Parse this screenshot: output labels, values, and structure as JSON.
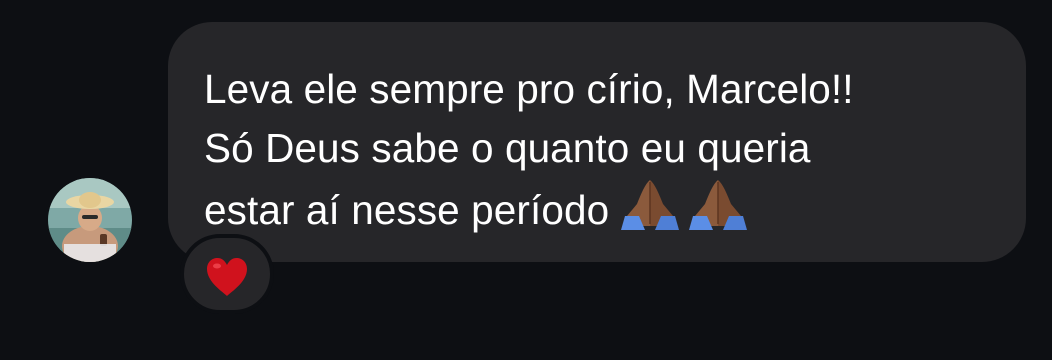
{
  "message": {
    "lines": [
      "Leva ele sempre pro círio, Marcelo!!",
      "Só Deus sabe o quanto eu queria",
      "estar aí nesse período"
    ],
    "emojis": [
      "folded-hands-icon",
      "folded-hands-icon"
    ],
    "reaction": "heart-icon"
  },
  "colors": {
    "background": "#0d0f13",
    "bubble": "#262629",
    "text": "#ffffff",
    "heart": "#d0121d",
    "skin": "#8b5a3c",
    "sleeve": "#5b8ee6"
  }
}
